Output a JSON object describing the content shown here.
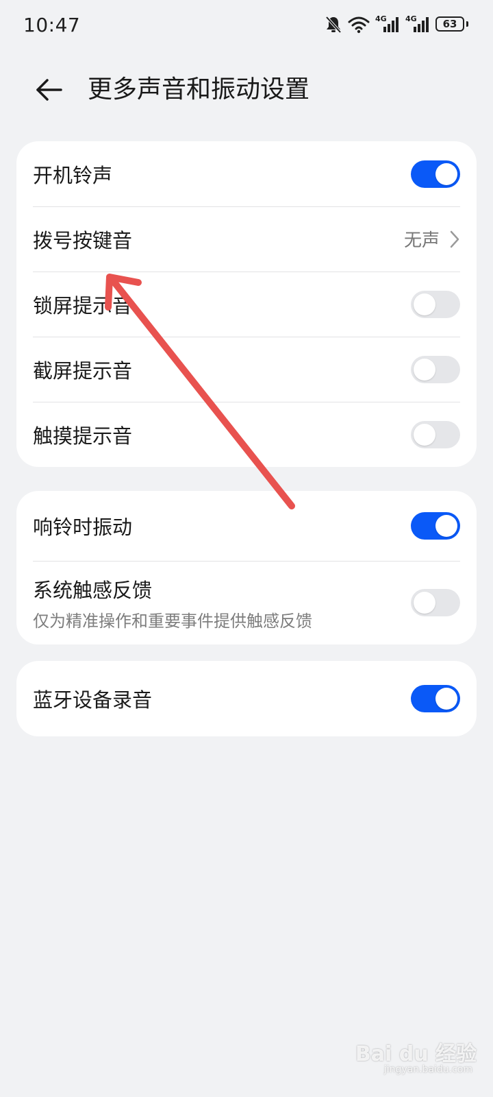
{
  "status_bar": {
    "time": "10:47",
    "signal_1_label": "4G",
    "signal_2_label": "4G",
    "battery": "63",
    "icons": [
      "mute-bell-icon",
      "wifi-icon",
      "signal-icon",
      "signal-icon",
      "battery-icon"
    ]
  },
  "header": {
    "title": "更多声音和振动设置",
    "back_icon": "back-arrow-icon"
  },
  "cards": [
    {
      "rows": [
        {
          "label": "开机铃声",
          "type": "toggle",
          "on": true
        },
        {
          "label": "拨号按键音",
          "type": "link",
          "value": "无声"
        },
        {
          "label": "锁屏提示音",
          "type": "toggle",
          "on": false
        },
        {
          "label": "截屏提示音",
          "type": "toggle",
          "on": false
        },
        {
          "label": "触摸提示音",
          "type": "toggle",
          "on": false
        }
      ]
    },
    {
      "rows": [
        {
          "label": "响铃时振动",
          "type": "toggle",
          "on": true
        },
        {
          "label": "系统触感反馈",
          "sub": "仅为精准操作和重要事件提供触感反馈",
          "type": "toggle",
          "on": false
        }
      ]
    },
    {
      "rows": [
        {
          "label": "蓝牙设备录音",
          "type": "toggle",
          "on": true
        }
      ]
    }
  ],
  "colors": {
    "accent": "#0a59f7",
    "toggle_off": "#e5e6e9",
    "background": "#f1f2f4",
    "annotation": "#e8524f"
  },
  "watermark": {
    "logo_text": "Bai du 经验",
    "url": "jingyan.baidu.com"
  }
}
